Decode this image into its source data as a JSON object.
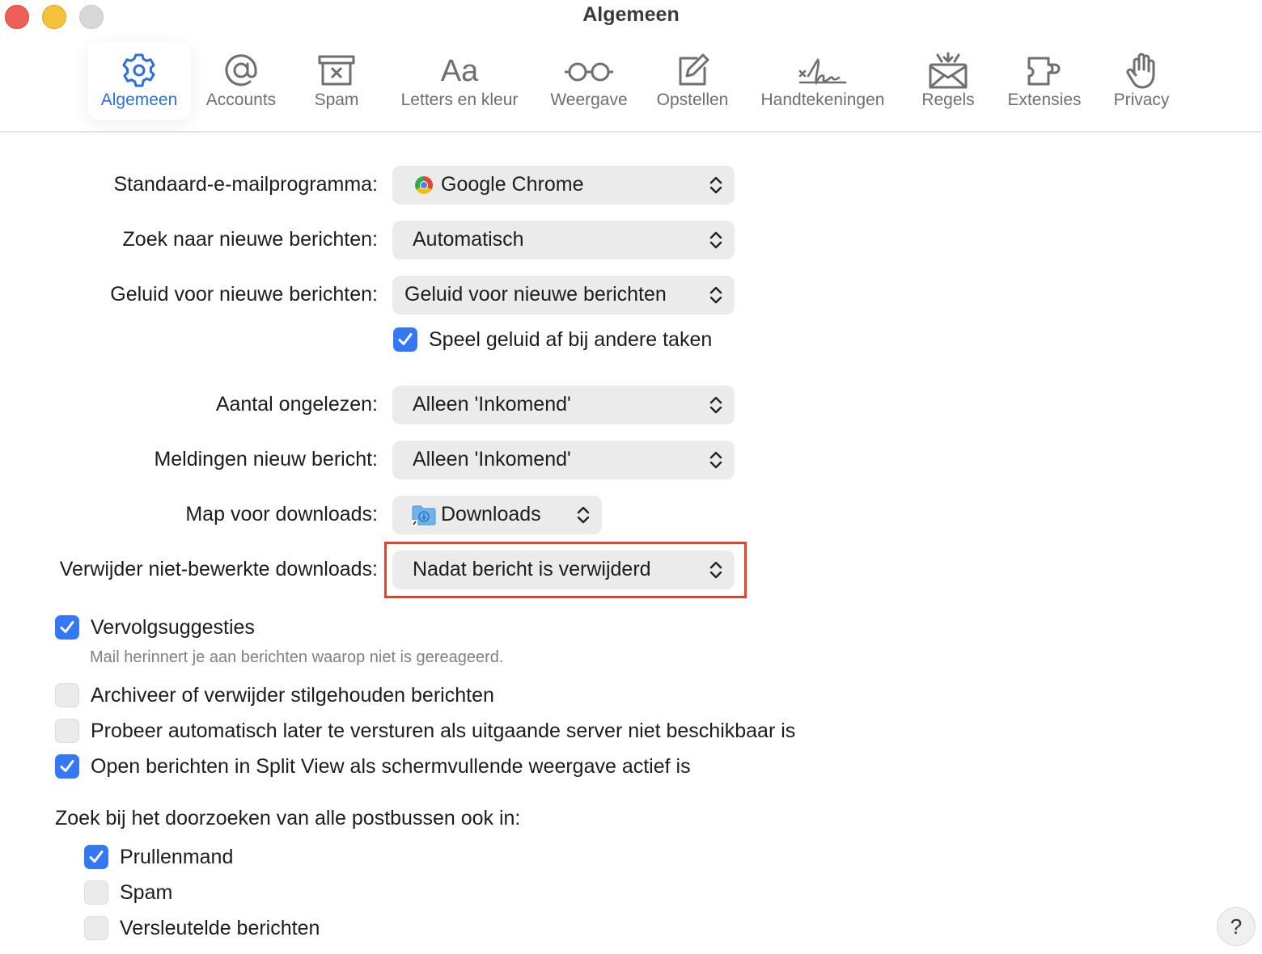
{
  "window": {
    "title": "Algemeen"
  },
  "toolbar": {
    "tabs": [
      {
        "label": "Algemeen",
        "icon": "gear-icon",
        "active": true
      },
      {
        "label": "Accounts",
        "icon": "at-sign-icon"
      },
      {
        "label": "Spam",
        "icon": "junk-tray-icon"
      },
      {
        "label": "Letters en kleur",
        "icon": "font-aa-icon"
      },
      {
        "label": "Weergave",
        "icon": "glasses-icon"
      },
      {
        "label": "Opstellen",
        "icon": "compose-icon"
      },
      {
        "label": "Handtekeningen",
        "icon": "signature-icon"
      },
      {
        "label": "Regels",
        "icon": "envelope-rules-icon"
      },
      {
        "label": "Extensies",
        "icon": "puzzle-icon"
      },
      {
        "label": "Privacy",
        "icon": "hand-icon"
      }
    ]
  },
  "settings": {
    "default_mail": {
      "label": "Standaard-e-mailprogramma:",
      "value": "Google Chrome",
      "icon": "chrome-icon"
    },
    "check_new": {
      "label": "Zoek naar nieuwe berichten:",
      "value": "Automatisch"
    },
    "new_sound": {
      "label": "Geluid voor nieuwe berichten:",
      "value": "Geluid voor nieuwe berichten"
    },
    "play_sound": {
      "label": "Speel geluid af bij andere taken",
      "checked": true
    },
    "unread_count": {
      "label": "Aantal ongelezen:",
      "value": "Alleen 'Inkomend'"
    },
    "notifications": {
      "label": "Meldingen nieuw bericht:",
      "value": "Alleen 'Inkomend'"
    },
    "download_folder": {
      "label": "Map voor downloads:",
      "value": "Downloads",
      "icon": "downloads-folder-icon"
    },
    "remove_downloads": {
      "label": "Verwijder niet-bewerkte downloads:",
      "value": "Nadat bericht is verwijderd",
      "highlight_color": "#e2452f"
    }
  },
  "options": {
    "followup": {
      "label": "Vervolgsuggesties",
      "checked": true,
      "description": "Mail herinnert je aan berichten waarop niet is gereageerd."
    },
    "archive_muted": {
      "label": "Archiveer of verwijder stilgehouden berichten",
      "checked": false
    },
    "retry_send": {
      "label": "Probeer automatisch later te versturen als uitgaande server niet beschikbaar is",
      "checked": false
    },
    "split_view": {
      "label": "Open berichten in Split View als schermvullende weergave actief is",
      "checked": true
    }
  },
  "search": {
    "heading": "Zoek bij het doorzoeken van alle postbussen ook in:",
    "items": [
      {
        "label": "Prullenmand",
        "checked": true
      },
      {
        "label": "Spam",
        "checked": false
      },
      {
        "label": "Versleutelde berichten",
        "checked": false
      }
    ]
  },
  "help": {
    "label": "?"
  },
  "colors": {
    "accent": "#3478f6",
    "active_tab_text": "#2e6fdc",
    "highlight": "#e2452f"
  }
}
